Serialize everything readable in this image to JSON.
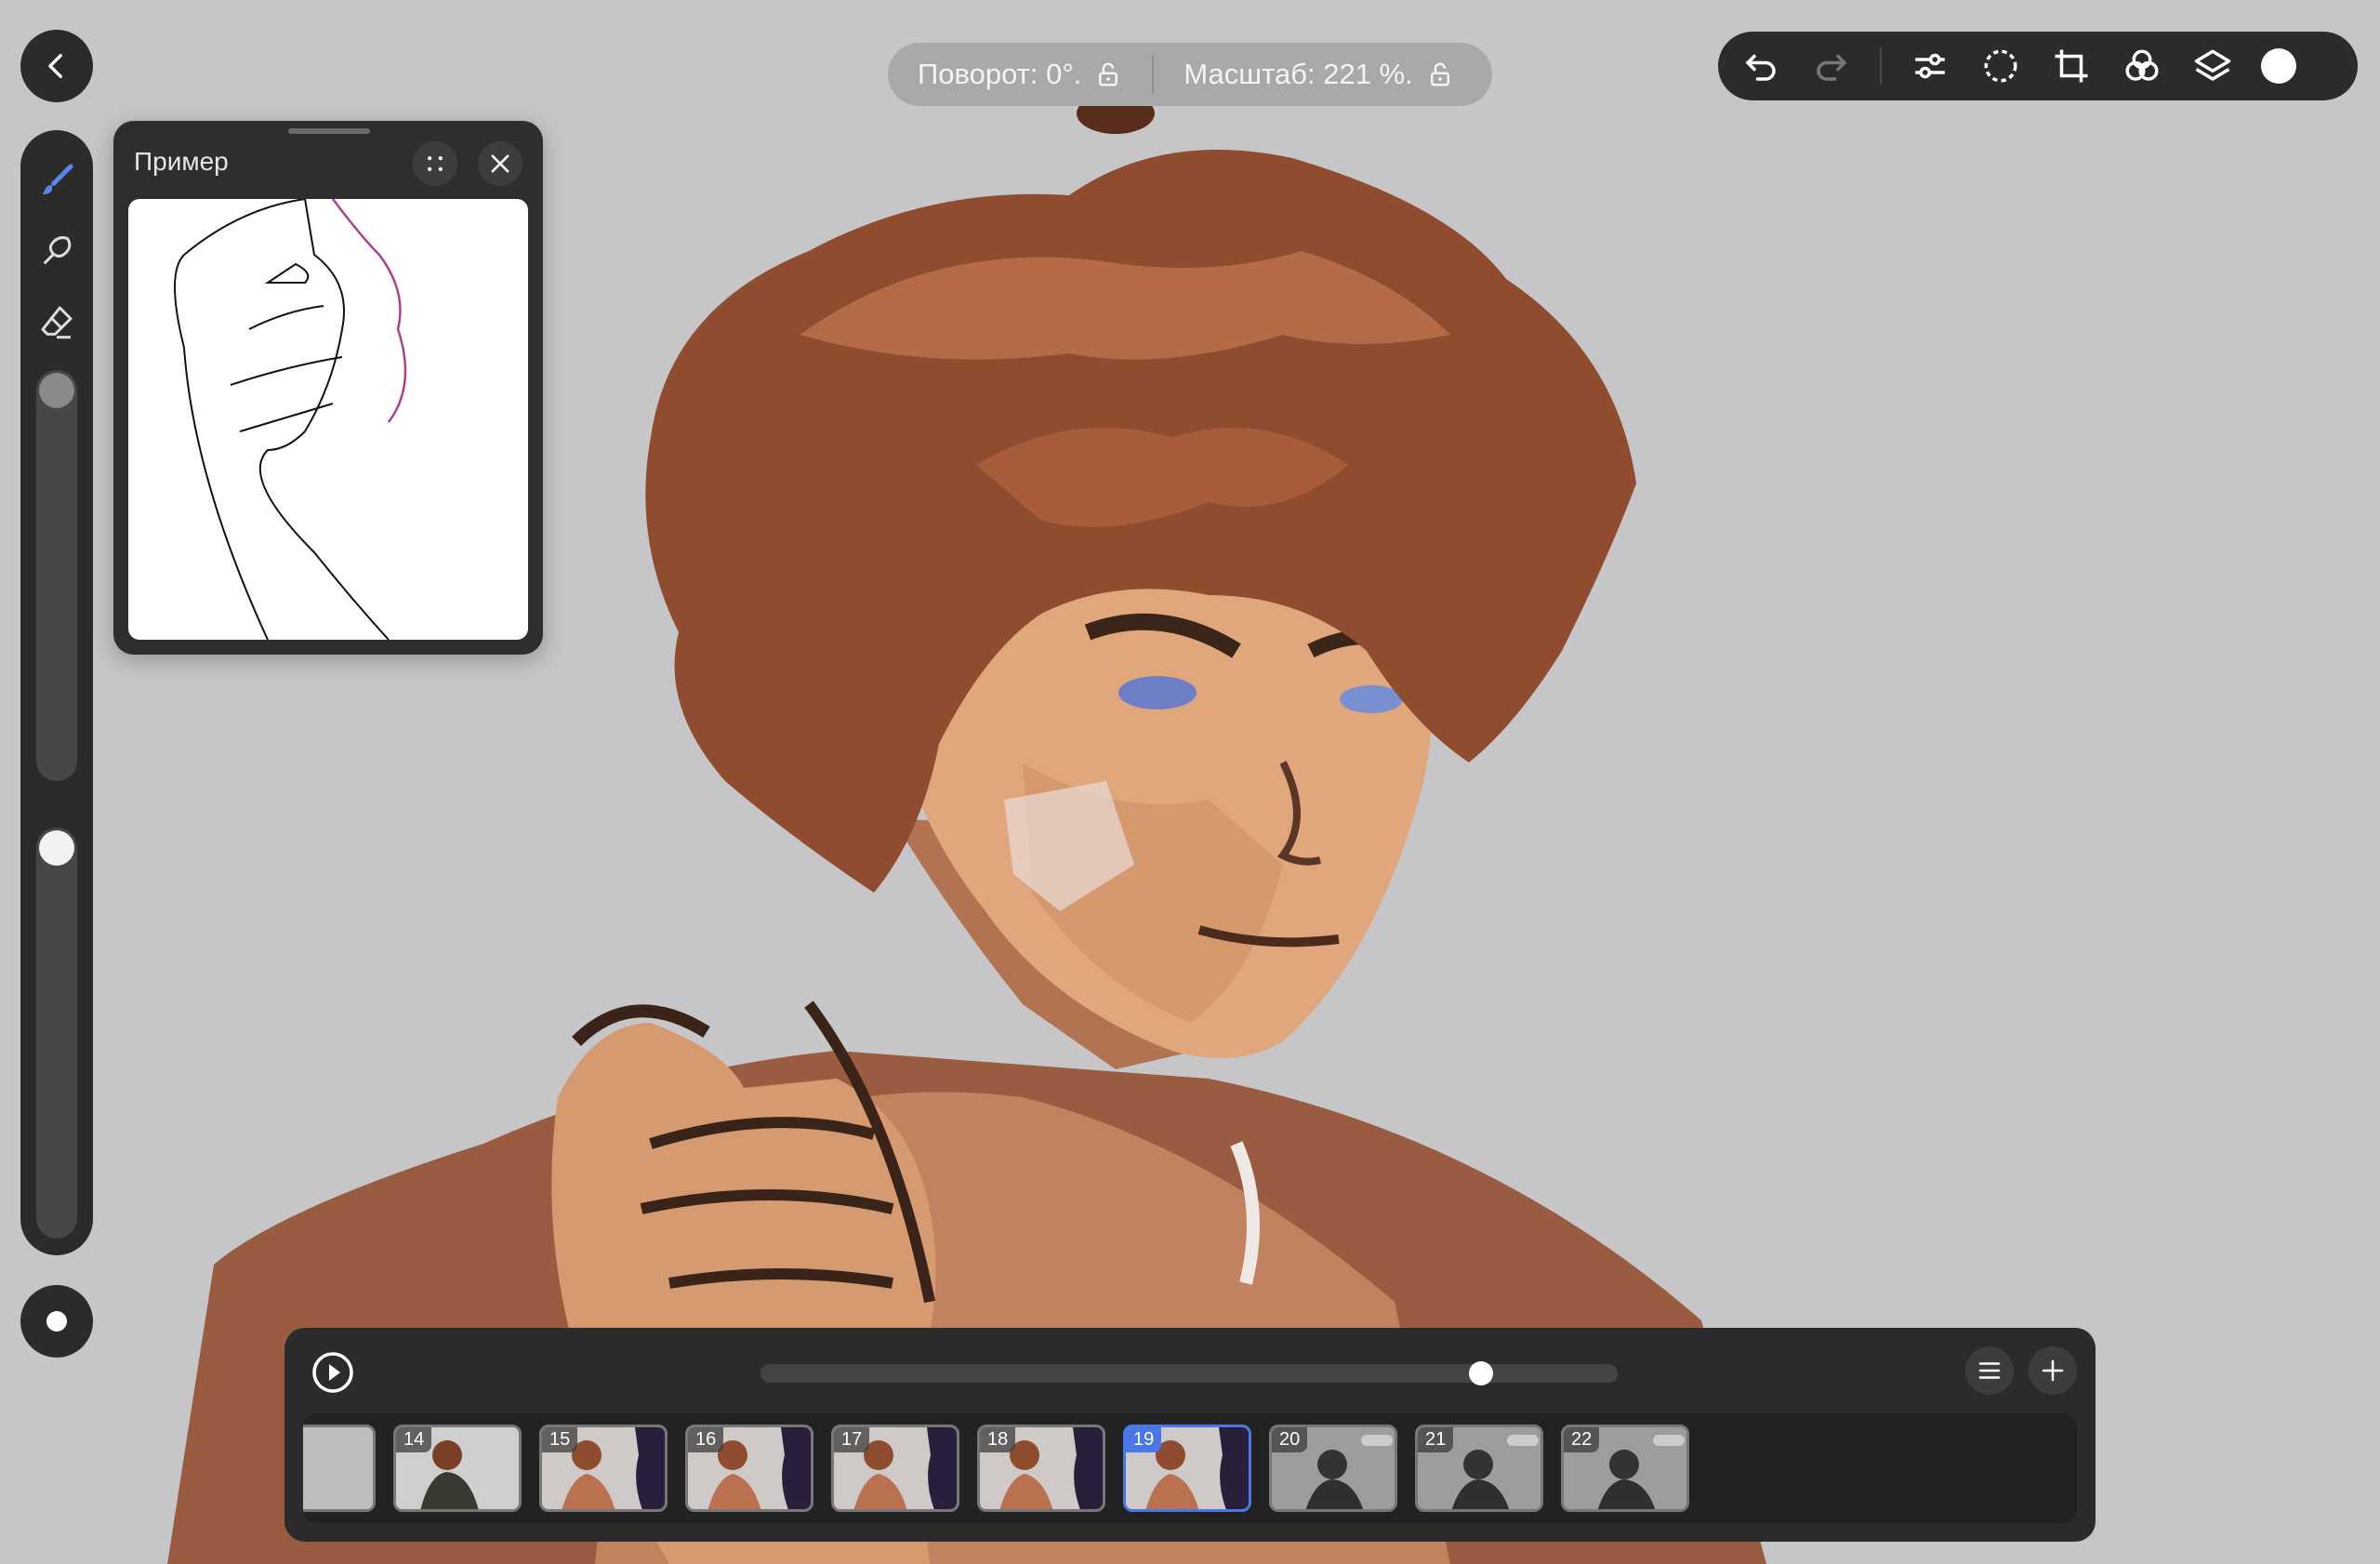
{
  "canvas": {
    "rotation_label": "Поворот: 0°.",
    "zoom_label": "Масштаб: 221 %."
  },
  "top_toolbar": {
    "icons": [
      "undo-icon",
      "redo-icon",
      "adjustments-icon",
      "selection-icon",
      "transform-icon",
      "blend-icon",
      "layers-icon"
    ],
    "current_color": "#ffffff"
  },
  "left_rail": {
    "tools": [
      "brush-icon",
      "smudge-icon",
      "eraser-icon"
    ],
    "active_tool": "brush",
    "brush_size_level": 1.0,
    "opacity_level": 1.0
  },
  "reference_panel": {
    "title": "Пример"
  },
  "timeline": {
    "playhead_fraction": 0.85,
    "frames": [
      {
        "number": "",
        "active": false,
        "style": "partial"
      },
      {
        "number": "14",
        "active": false,
        "style": "dark-figure"
      },
      {
        "number": "15",
        "active": false,
        "style": "warm"
      },
      {
        "number": "16",
        "active": false,
        "style": "warm"
      },
      {
        "number": "17",
        "active": false,
        "style": "warm"
      },
      {
        "number": "18",
        "active": false,
        "style": "warm"
      },
      {
        "number": "19",
        "active": true,
        "style": "warm"
      },
      {
        "number": "20",
        "active": false,
        "style": "grey"
      },
      {
        "number": "21",
        "active": false,
        "style": "grey"
      },
      {
        "number": "22",
        "active": false,
        "style": "grey"
      }
    ]
  },
  "colors": {
    "accent": "#4a77e8",
    "panel_bg": "#2b2b2b",
    "canvas_bg": "#c6c6c8"
  }
}
